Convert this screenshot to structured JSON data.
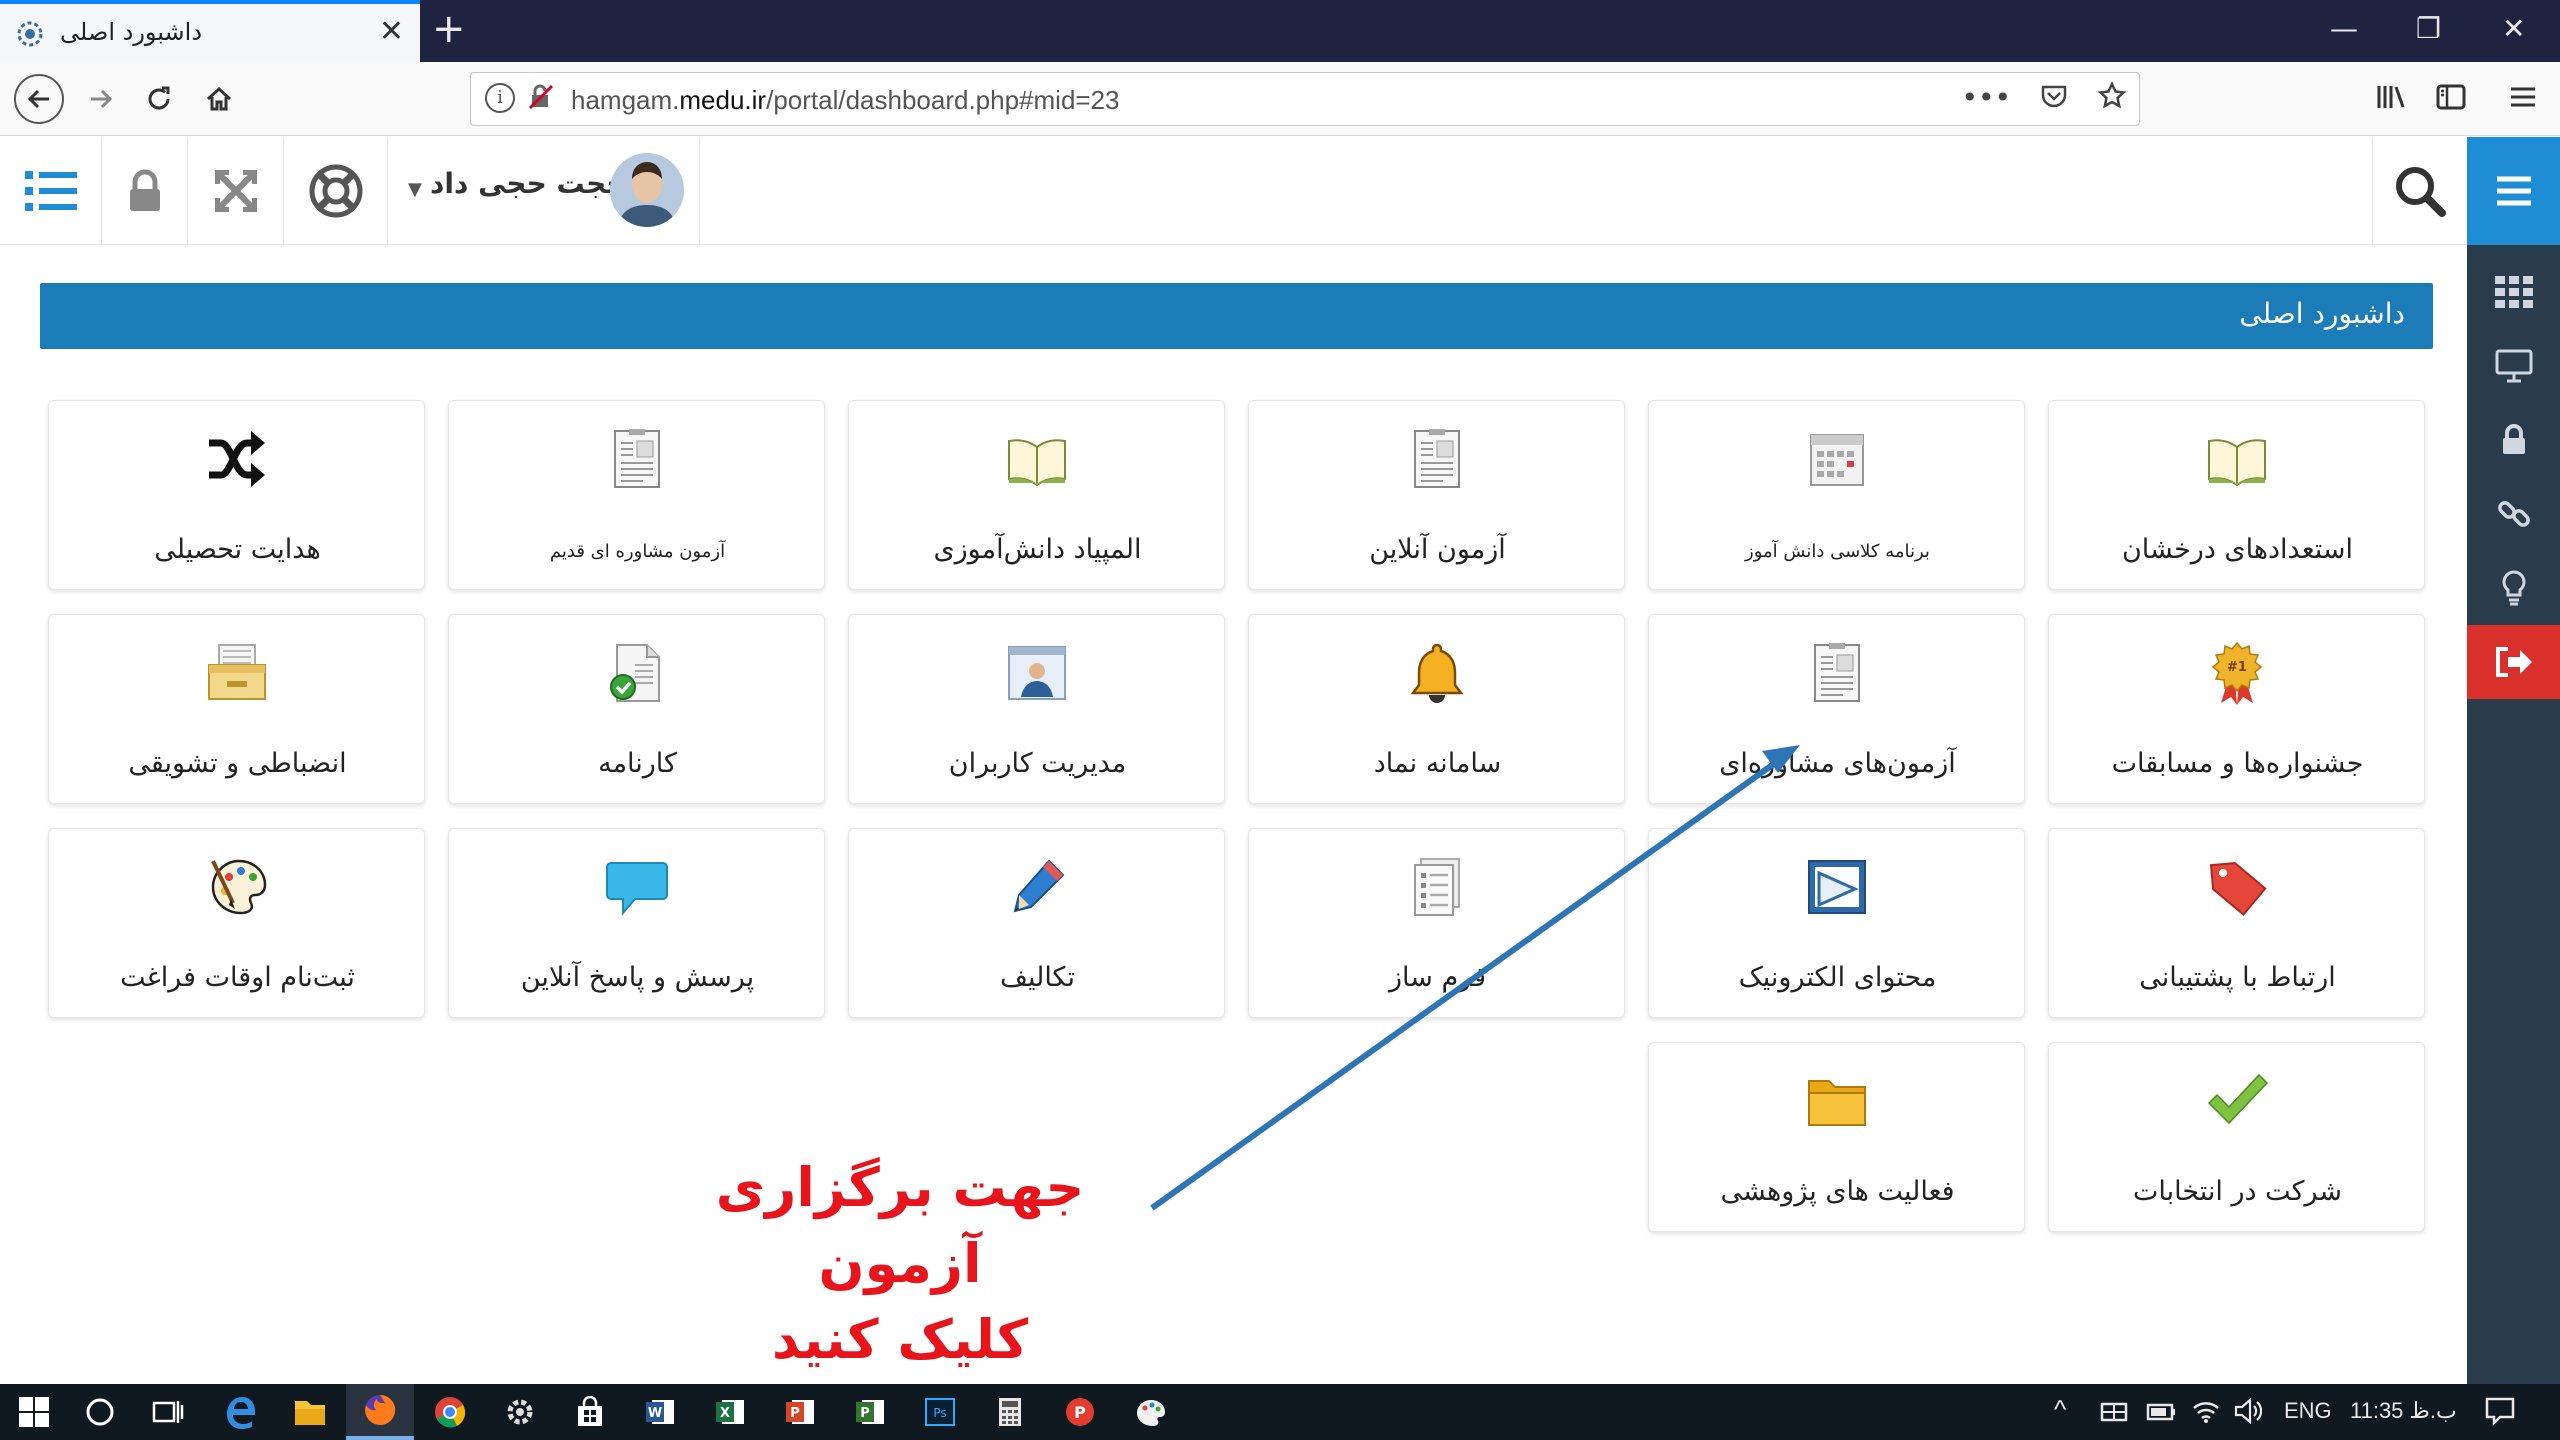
{
  "browser": {
    "tab_title": "داشبورد اصلی",
    "tab_close": "✕",
    "new_tab": "+",
    "url_prefix": "hamgam.",
    "url_domain": "medu.ir",
    "url_path": "/portal/dashboard.php#mid=23",
    "page_actions": "•••",
    "window_controls": {
      "minimize": "—",
      "restore": "❐",
      "close": "✕"
    }
  },
  "header": {
    "user_name": "حجت حجی داد",
    "user_caret": "▼"
  },
  "dashboard": {
    "title": "داشبورد اصلی",
    "tiles": [
      {
        "label": "هدایت تحصیلی",
        "icon": "shuffle-icon"
      },
      {
        "label": "آزمون مشاوره ای قدیم",
        "icon": "exam-sheet-icon"
      },
      {
        "label": "المپیاد دانش‌آموزی",
        "icon": "open-book-icon"
      },
      {
        "label": "آزمون آنلاین",
        "icon": "exam-sheet-icon"
      },
      {
        "label": "برنامه کلاسی دانش آموز",
        "icon": "calendar-icon"
      },
      {
        "label": "استعدادهای درخشان",
        "icon": "open-book-icon"
      },
      {
        "label": "انضباطی و تشویقی",
        "icon": "drawer-icon"
      },
      {
        "label": "کارنامه",
        "icon": "report-card-icon"
      },
      {
        "label": "مدیریت کاربران",
        "icon": "user-card-icon"
      },
      {
        "label": "سامانه نماد",
        "icon": "bell-icon"
      },
      {
        "label": "آزمون‌های مشاوره‌ای",
        "icon": "exam-sheet-icon"
      },
      {
        "label": "جشنواره‌ها و مسابقات",
        "icon": "award-badge-icon"
      },
      {
        "label": "ثبت‌نام اوقات فراغت",
        "icon": "paint-palette-icon"
      },
      {
        "label": "پرسش و پاسخ آنلاین",
        "icon": "chat-bubble-icon"
      },
      {
        "label": "تکالیف",
        "icon": "pencil-icon"
      },
      {
        "label": "فرم ساز",
        "icon": "form-list-icon"
      },
      {
        "label": "محتوای الکترونیک",
        "icon": "presentation-icon"
      },
      {
        "label": "ارتباط با پشتیبانی",
        "icon": "tag-icon"
      },
      {
        "label": "فعالیت های پژوهشی",
        "icon": "folder-icon"
      },
      {
        "label": "شرکت در انتخابات",
        "icon": "checkmark-icon"
      }
    ]
  },
  "annotation": {
    "line1": "جهت برگزاری آزمون",
    "line2": "کلیک کنید"
  },
  "taskbar": {
    "chevron": "^",
    "language": "ENG",
    "time": "11:35 ب.ظ"
  },
  "colors": {
    "dashboard_bar": "#1c7cb8",
    "sidebar": "#2a3b4c",
    "sidebar_menu": "#1f8dd6",
    "logout": "#d9302c",
    "annotation": "#e8141c",
    "arrow": "#2e75b6"
  }
}
